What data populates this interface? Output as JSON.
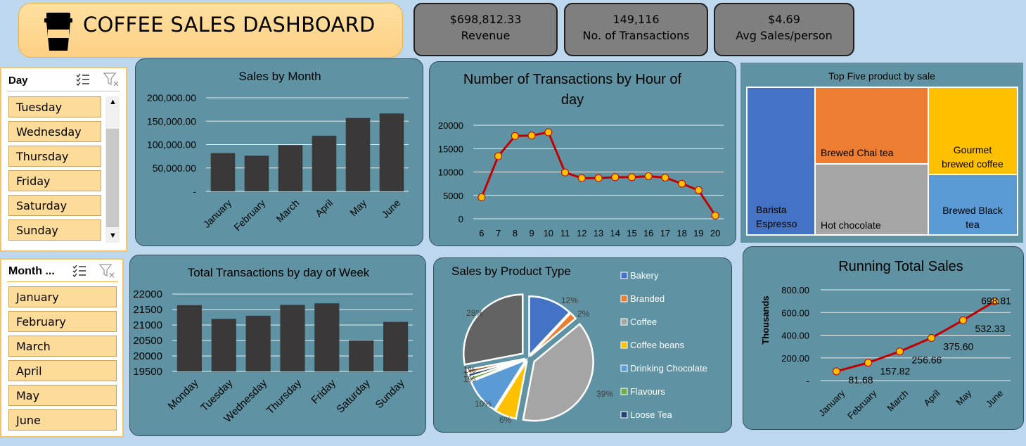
{
  "header": {
    "title": "COFFEE SALES DASHBOARD",
    "icon": "coffee-cup-icon"
  },
  "kpis": [
    {
      "value": "$698,812.33",
      "label": "Revenue"
    },
    {
      "value": "149,116",
      "label": "No. of Transactions"
    },
    {
      "value": "$4.69",
      "label": "Avg Sales/person"
    }
  ],
  "slicers": {
    "day": {
      "title": "Day",
      "items": [
        "Tuesday",
        "Wednesday",
        "Thursday",
        "Friday",
        "Saturday",
        "Sunday"
      ]
    },
    "month": {
      "title": "Month ...",
      "items": [
        "January",
        "February",
        "March",
        "April",
        "May",
        "June"
      ]
    }
  },
  "colors": {
    "bar": "#3a3838",
    "line": "#c00000",
    "marker": "#ffc000",
    "panel": "#5f93a3"
  },
  "chart_data": [
    {
      "type": "bar",
      "title": "Sales by Month",
      "categories": [
        "January",
        "February",
        "March",
        "April",
        "May",
        "June"
      ],
      "values": [
        81678,
        76145,
        98835,
        118941,
        156728,
        166486
      ],
      "ylim": [
        0,
        200000
      ],
      "yticks": [
        "-",
        "50,000.00",
        "100,000.00",
        "150,000.00",
        "200,000.00"
      ],
      "grid": true
    },
    {
      "type": "line",
      "title": "Number of Transactions by Hour of day",
      "x": [
        6,
        7,
        8,
        9,
        10,
        11,
        12,
        13,
        14,
        15,
        16,
        17,
        18,
        19,
        20
      ],
      "values": [
        4600,
        13400,
        17700,
        17800,
        18500,
        9900,
        8700,
        8700,
        8900,
        8900,
        9100,
        8800,
        7500,
        6100,
        700
      ],
      "ylim": [
        0,
        20000
      ],
      "yticks": [
        "0",
        "5000",
        "10000",
        "15000",
        "20000"
      ],
      "grid": true
    },
    {
      "type": "treemap",
      "title": "Top Five product by sale",
      "items": [
        {
          "label": "Barista Espresso",
          "color": "#4472c4"
        },
        {
          "label": "Brewed Chai tea",
          "color": "#ed7d31"
        },
        {
          "label": "Hot chocolate",
          "color": "#a5a5a5"
        },
        {
          "label": "Gourmet brewed coffee",
          "color": "#ffc000"
        },
        {
          "label": "Brewed Black tea",
          "color": "#5b9bd5"
        }
      ]
    },
    {
      "type": "bar",
      "title": "Total Transactions by day of Week",
      "categories": [
        "Monday",
        "Tuesday",
        "Wednesday",
        "Thursday",
        "Friday",
        "Saturday",
        "Sunday"
      ],
      "values": [
        21640,
        21200,
        21300,
        21650,
        21700,
        20500,
        21100
      ],
      "ylim": [
        19500,
        22000
      ],
      "yticks": [
        "19500",
        "20000",
        "20500",
        "21000",
        "21500",
        "22000"
      ],
      "grid": true
    },
    {
      "type": "pie",
      "title": "Sales by Product Type",
      "series": [
        {
          "name": "Bakery",
          "value": 12,
          "label": "12%",
          "color": "#4472c4"
        },
        {
          "name": "Branded",
          "value": 2,
          "label": "2%",
          "color": "#ed7d31"
        },
        {
          "name": "Coffee",
          "value": 39,
          "label": "39%",
          "color": "#a5a5a5"
        },
        {
          "name": "Coffee beans",
          "value": 6,
          "label": "6%",
          "color": "#ffc000"
        },
        {
          "name": "Drinking Chocolate",
          "value": 10,
          "label": "10%",
          "color": "#5b9bd5"
        },
        {
          "name": "Flavours",
          "value": 1,
          "label": "1%",
          "color": "#70ad47"
        },
        {
          "name": "Loose Tea",
          "value": 1,
          "label": "1%",
          "color": "#264478"
        },
        {
          "name": "",
          "value": 1,
          "label": "1%",
          "color": "#9e480e"
        },
        {
          "name": "",
          "value": 28,
          "label": "28%",
          "color": "#636363"
        }
      ],
      "legend_position": "right"
    },
    {
      "type": "line",
      "title": "Running Total Sales",
      "categories": [
        "January",
        "February",
        "March",
        "April",
        "May",
        "June"
      ],
      "values": [
        81.68,
        157.82,
        256.66,
        375.6,
        532.33,
        698.81
      ],
      "labels": [
        "81.68",
        "157.82",
        "256.66",
        "375.60",
        "532.33",
        "698.81"
      ],
      "ylabel": "Thousands",
      "ylim": [
        0,
        800
      ],
      "yticks": [
        "-",
        "200.00",
        "400.00",
        "600.00",
        "800.00"
      ],
      "grid": true
    }
  ]
}
